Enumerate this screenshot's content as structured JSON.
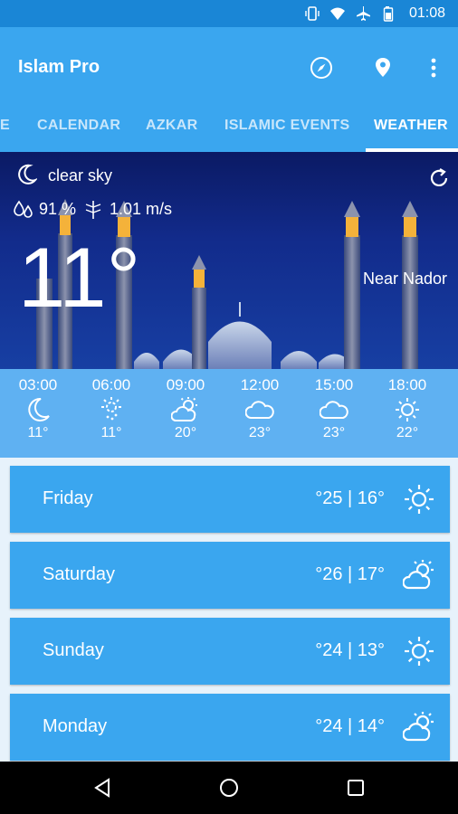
{
  "status_bar": {
    "time": "01:08",
    "icons": [
      "vibrate-icon",
      "wifi-icon",
      "airplane-icon",
      "battery-icon"
    ]
  },
  "app_bar": {
    "title": "Islam Pro",
    "actions": [
      "compass-icon",
      "location-pin-icon",
      "more-vert-icon"
    ]
  },
  "tabs": {
    "items": [
      {
        "label": "E",
        "active": false
      },
      {
        "label": "CALENDAR",
        "active": false
      },
      {
        "label": "AZKAR",
        "active": false
      },
      {
        "label": "ISLAMIC EVENTS",
        "active": false
      },
      {
        "label": "WEATHER",
        "active": true
      }
    ]
  },
  "current": {
    "condition": "clear sky",
    "humidity": "91 %",
    "wind": "1.01 m/s",
    "temperature": "11°",
    "location": "Near Nador"
  },
  "hourly": [
    {
      "time": "03:00",
      "temp": "11°",
      "icon": "moon-icon"
    },
    {
      "time": "06:00",
      "temp": "11°",
      "icon": "partly-cloudy-sun-icon"
    },
    {
      "time": "09:00",
      "temp": "20°",
      "icon": "sun-cloud-icon"
    },
    {
      "time": "12:00",
      "temp": "23°",
      "icon": "cloud-icon"
    },
    {
      "time": "15:00",
      "temp": "23°",
      "icon": "cloud-icon"
    },
    {
      "time": "18:00",
      "temp": "22°",
      "icon": "sun-icon"
    }
  ],
  "daily": [
    {
      "day": "Friday",
      "temps": "°25 | 16°",
      "icon": "sun-icon"
    },
    {
      "day": "Saturday",
      "temps": "°26 | 17°",
      "icon": "sun-cloud-icon"
    },
    {
      "day": "Sunday",
      "temps": "°24 | 13°",
      "icon": "sun-icon"
    },
    {
      "day": "Monday",
      "temps": "°24 | 14°",
      "icon": "sun-cloud-icon"
    }
  ],
  "colors": {
    "primary": "#3aa6ef",
    "status_bar": "#1a86d6",
    "hourly_strip": "#5fb1f2",
    "list_bg": "#e7f2fb"
  }
}
